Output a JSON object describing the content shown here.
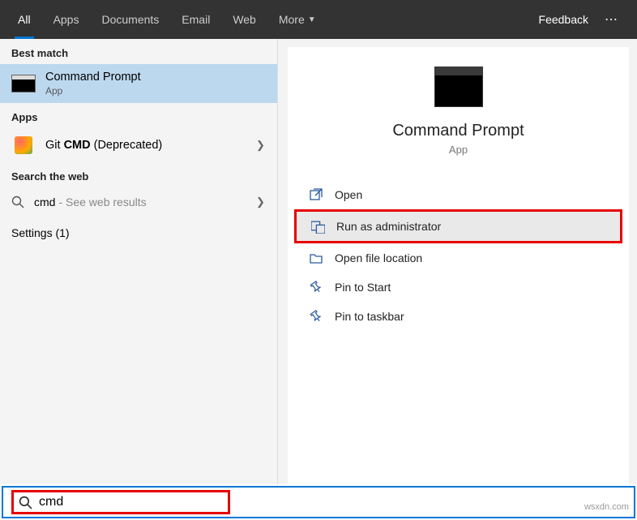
{
  "topbar": {
    "tabs": [
      "All",
      "Apps",
      "Documents",
      "Email",
      "Web",
      "More"
    ],
    "active_tab": "All",
    "feedback": "Feedback"
  },
  "left": {
    "best_match_header": "Best match",
    "best_match": {
      "title": "Command Prompt",
      "subtitle": "App"
    },
    "apps_header": "Apps",
    "apps_item": {
      "prefix": "Git ",
      "bold": "CMD",
      "suffix": " (Deprecated)"
    },
    "web_header": "Search the web",
    "web_item": {
      "term": "cmd",
      "hint": "- See web results"
    },
    "settings_label": "Settings (1)"
  },
  "preview": {
    "title": "Command Prompt",
    "subtitle": "App",
    "actions": {
      "open": "Open",
      "run_admin": "Run as administrator",
      "open_location": "Open file location",
      "pin_start": "Pin to Start",
      "pin_taskbar": "Pin to taskbar"
    }
  },
  "search": {
    "value": "cmd"
  },
  "watermark": "wsxdn.com"
}
